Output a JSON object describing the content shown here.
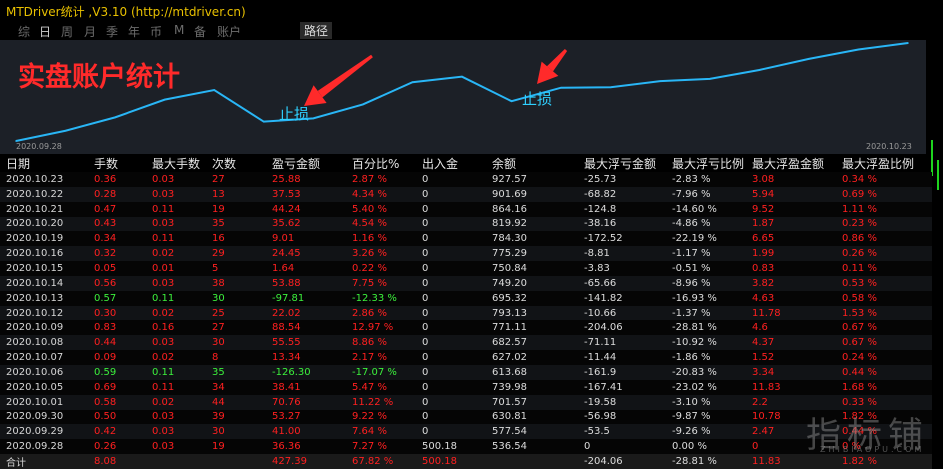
{
  "window": {
    "title": "MTDriver统计 ,V3.10 (http://mtdriver.cn)"
  },
  "tabs": [
    {
      "label": "综"
    },
    {
      "label": "日"
    },
    {
      "label": "周"
    },
    {
      "label": "月"
    },
    {
      "label": "季"
    },
    {
      "label": "年"
    },
    {
      "label": "币"
    },
    {
      "label": "M"
    },
    {
      "label": "备"
    },
    {
      "label": "账户"
    },
    {
      "label": "路径"
    }
  ],
  "chart": {
    "overlay_title": "实盘账户统计",
    "annotation_1": "止损",
    "annotation_2": "止损",
    "date_start": "2020.09.28",
    "date_end": "2020.10.23",
    "line_color": "#29b6f6",
    "arrow_color": "#ff2a2a"
  },
  "chart_data": {
    "type": "line",
    "title": "实盘账户统计",
    "x": [
      "2020.09.28",
      "2020.09.29",
      "2020.09.30",
      "2020.10.01",
      "2020.10.05",
      "2020.10.06",
      "2020.10.07",
      "2020.10.08",
      "2020.10.09",
      "2020.10.12",
      "2020.10.13",
      "2020.10.14",
      "2020.10.15",
      "2020.10.16",
      "2020.10.19",
      "2020.10.20",
      "2020.10.21",
      "2020.10.22",
      "2020.10.23"
    ],
    "series": [
      {
        "values": [
          536.54,
          577.54,
          630.81,
          701.57,
          739.98,
          613.68,
          627.02,
          682.57,
          771.11,
          793.13,
          695.32,
          749.2,
          750.84,
          775.29,
          784.3,
          819.92,
          864.16,
          901.69,
          927.57
        ]
      }
    ],
    "annotations": [
      "止损",
      "止损"
    ],
    "grid": false
  },
  "table": {
    "headers": [
      "日期",
      "手数",
      "最大手数",
      "次数",
      "盈亏金额",
      "百分比%",
      "出入金",
      "余额",
      "最大浮亏金额",
      "最大浮亏比例",
      "最大浮盈金额",
      "最大浮盈比例"
    ],
    "rows": [
      [
        "2020.10.23",
        "0.36",
        "0.03",
        "27",
        "25.88",
        "2.87 %",
        "0",
        "927.57",
        "-25.73",
        "-2.83 %",
        "3.08",
        "0.34 %"
      ],
      [
        "2020.10.22",
        "0.28",
        "0.03",
        "13",
        "37.53",
        "4.34 %",
        "0",
        "901.69",
        "-68.82",
        "-7.96 %",
        "5.94",
        "0.69 %"
      ],
      [
        "2020.10.21",
        "0.47",
        "0.11",
        "19",
        "44.24",
        "5.40 %",
        "0",
        "864.16",
        "-124.8",
        "-14.60 %",
        "9.52",
        "1.11 %"
      ],
      [
        "2020.10.20",
        "0.43",
        "0.03",
        "35",
        "35.62",
        "4.54 %",
        "0",
        "819.92",
        "-38.16",
        "-4.86 %",
        "1.87",
        "0.23 %"
      ],
      [
        "2020.10.19",
        "0.34",
        "0.11",
        "16",
        "9.01",
        "1.16 %",
        "0",
        "784.30",
        "-172.52",
        "-22.19 %",
        "6.65",
        "0.86 %"
      ],
      [
        "2020.10.16",
        "0.32",
        "0.02",
        "29",
        "24.45",
        "3.26 %",
        "0",
        "775.29",
        "-8.81",
        "-1.17 %",
        "1.99",
        "0.26 %"
      ],
      [
        "2020.10.15",
        "0.05",
        "0.01",
        "5",
        "1.64",
        "0.22 %",
        "0",
        "750.84",
        "-3.83",
        "-0.51 %",
        "0.83",
        "0.11 %"
      ],
      [
        "2020.10.14",
        "0.56",
        "0.03",
        "38",
        "53.88",
        "7.75 %",
        "0",
        "749.20",
        "-65.66",
        "-8.96 %",
        "3.82",
        "0.53 %"
      ],
      [
        "2020.10.13",
        "0.57",
        "0.11",
        "30",
        "-97.81",
        "-12.33 %",
        "0",
        "695.32",
        "-141.82",
        "-16.93 %",
        "4.63",
        "0.58 %"
      ],
      [
        "2020.10.12",
        "0.30",
        "0.02",
        "25",
        "22.02",
        "2.86 %",
        "0",
        "793.13",
        "-10.66",
        "-1.37 %",
        "11.78",
        "1.53 %"
      ],
      [
        "2020.10.09",
        "0.83",
        "0.16",
        "27",
        "88.54",
        "12.97 %",
        "0",
        "771.11",
        "-204.06",
        "-28.81 %",
        "4.6",
        "0.67 %"
      ],
      [
        "2020.10.08",
        "0.44",
        "0.03",
        "30",
        "55.55",
        "8.86 %",
        "0",
        "682.57",
        "-71.11",
        "-10.92 %",
        "4.37",
        "0.67 %"
      ],
      [
        "2020.10.07",
        "0.09",
        "0.02",
        "8",
        "13.34",
        "2.17 %",
        "0",
        "627.02",
        "-11.44",
        "-1.86 %",
        "1.52",
        "0.24 %"
      ],
      [
        "2020.10.06",
        "0.59",
        "0.11",
        "35",
        "-126.30",
        "-17.07 %",
        "0",
        "613.68",
        "-161.9",
        "-20.83 %",
        "3.34",
        "0.44 %"
      ],
      [
        "2020.10.05",
        "0.69",
        "0.11",
        "34",
        "38.41",
        "5.47 %",
        "0",
        "739.98",
        "-167.41",
        "-23.02 %",
        "11.83",
        "1.68 %"
      ],
      [
        "2020.10.01",
        "0.58",
        "0.02",
        "44",
        "70.76",
        "11.22 %",
        "0",
        "701.57",
        "-19.58",
        "-3.10 %",
        "2.2",
        "0.33 %"
      ],
      [
        "2020.09.30",
        "0.50",
        "0.03",
        "39",
        "53.27",
        "9.22 %",
        "0",
        "630.81",
        "-56.98",
        "-9.87 %",
        "10.78",
        "1.82 %"
      ],
      [
        "2020.09.29",
        "0.42",
        "0.03",
        "30",
        "41.00",
        "7.64 %",
        "0",
        "577.54",
        "-53.5",
        "-9.26 %",
        "2.47",
        "0.44 %"
      ],
      [
        "2020.09.28",
        "0.26",
        "0.03",
        "19",
        "36.36",
        "7.27 %",
        "500.18",
        "536.54",
        "0",
        "0.00 %",
        "0",
        "0 %"
      ]
    ],
    "loss_rows": [
      8,
      13
    ],
    "total": [
      "合计",
      "8.08",
      "",
      "",
      "427.39",
      "67.82 %",
      "500.18",
      "",
      "-204.06",
      "-28.81 %",
      "11.83",
      "1.82 %"
    ]
  },
  "watermark": {
    "text": "指标铺",
    "sub": "ZHIBIAOPU.COM"
  }
}
